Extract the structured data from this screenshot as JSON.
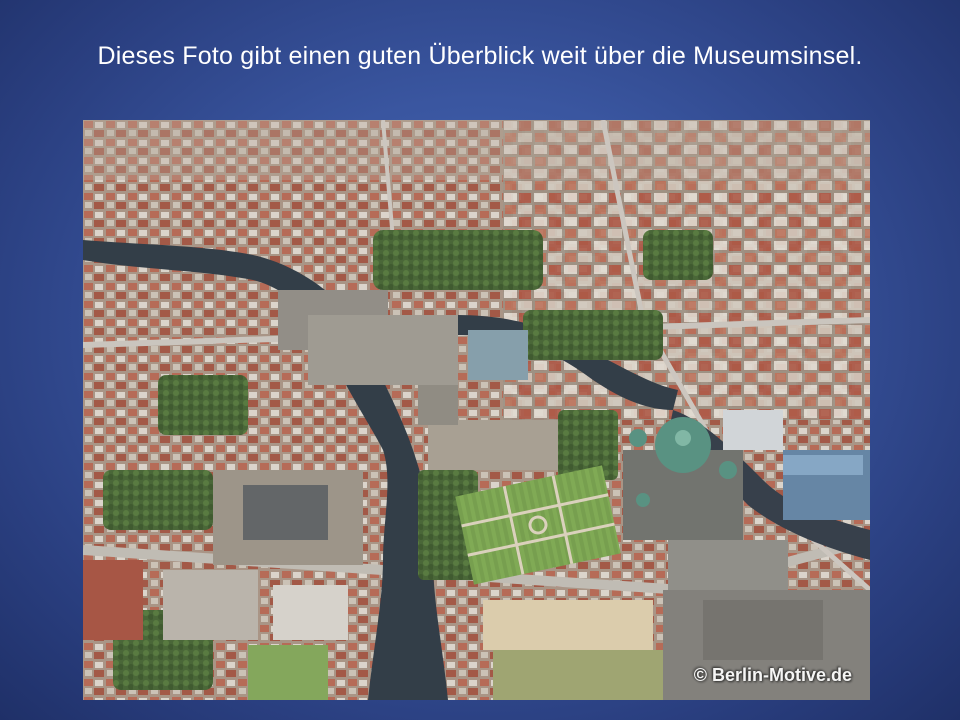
{
  "slide": {
    "title": "Dieses Foto gibt einen guten Überblick weit über die Museumsinsel."
  },
  "photo": {
    "subject": "aerial-view-museum-island-berlin",
    "watermark": "© Berlin-Motive.de"
  },
  "colors": {
    "background": "#3a56a0",
    "title_text": "#ffffff"
  }
}
